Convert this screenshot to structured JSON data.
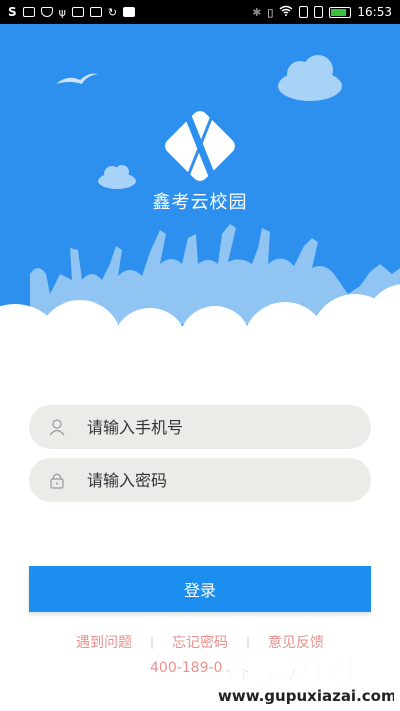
{
  "status_bar": {
    "time": "16:53",
    "carrier_letter": "S"
  },
  "header": {
    "app_name": "鑫考云校园",
    "background_color": "#2d8fee"
  },
  "form": {
    "phone_placeholder": "请输入手机号",
    "password_placeholder": "请输入密码",
    "phone_icon": "user-icon",
    "password_icon": "lock-icon"
  },
  "login_button": {
    "label": "登录",
    "color": "#1c8ef0"
  },
  "links": {
    "problem": "遇到问题",
    "forgot": "忘记密码",
    "feedback": "意见反馈",
    "separator": "|",
    "phone": "400-189-0"
  },
  "watermark": {
    "title": "谷普软件园",
    "url": "www.gupuxiazai.com"
  }
}
